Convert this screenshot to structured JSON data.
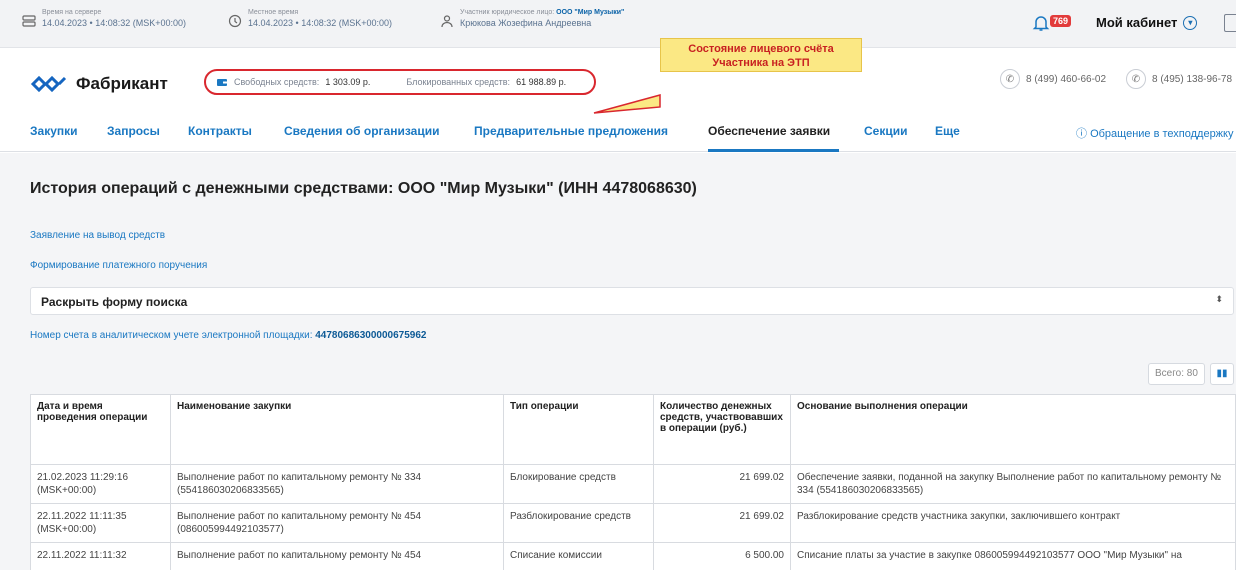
{
  "topbar": {
    "server_time_label": "Время на сервере",
    "server_time_value": "14.04.2023 • 14:08:32 (MSK+00:00)",
    "local_time_label": "Местное время",
    "local_time_value": "14.04.2023 • 14:08:32 (MSK+00:00)",
    "participant_label": "Участник юридическое лицо:",
    "participant_org": "ООО \"Мир Музыки\"",
    "participant_name": "Крюкова Жозефина Андреевна",
    "notifications_count": "769",
    "cabinet_label": "Мой кабинет"
  },
  "header": {
    "logo_text": "Фабрикант",
    "free_funds_label": "Свободных средств:",
    "free_funds_value": "1 303.09 р.",
    "blocked_funds_label": "Блокированных средств:",
    "blocked_funds_value": "61 988.89 р.",
    "callout_line1": "Состояние лицевого счёта",
    "callout_line2": "Участника на ЭТП",
    "phone1": "8 (499) 460-66-02",
    "phone2": "8 (495) 138-96-78"
  },
  "nav": {
    "items": [
      "Закупки",
      "Запросы",
      "Контракты",
      "Сведения об организации",
      "Предварительные предложения",
      "Обеспечение заявки",
      "Секции",
      "Еще"
    ],
    "active_index": 5,
    "support": "Обращение в техподдержку"
  },
  "page": {
    "title": "История операций с денежными средствами: ООО \"Мир Музыки\" (ИНН 4478068630)",
    "link_withdraw": "Заявление на вывод средств",
    "link_payment": "Формирование платежного поручения",
    "search_toggle": "Раскрыть форму поиска",
    "account_label": "Номер счета в аналитическом учете электронной площадки:",
    "account_number": "44780686300000675962",
    "total_label": "Всего: 80"
  },
  "table": {
    "headers": [
      "Дата и время проведения операции",
      "Наименование закупки",
      "Тип операции",
      "Количество денежных средств, участвовавших в операции (руб.)",
      "Основание выполнения операции"
    ],
    "rows": [
      [
        "21.02.2023 11:29:16 (MSK+00:00)",
        "Выполнение работ по капитальному ремонту № 334 (554186030206833565)",
        "Блокирование средств",
        "21 699.02",
        "Обеспечение заявки, поданной на закупку Выполнение работ по капитальному ремонту № 334 (554186030206833565)"
      ],
      [
        "22.11.2022 11:11:35 (MSK+00:00)",
        "Выполнение работ по капитальному ремонту № 454 (086005994492103577)",
        "Разблокирование средств",
        "21 699.02",
        "Разблокирование средств участника закупки, заключившего контракт"
      ],
      [
        "22.11.2022 11:11:32",
        "Выполнение работ по капитальному ремонту № 454",
        "Списание комиссии",
        "6 500.00",
        "Списание платы за участие в закупке 086005994492103577 ООО \"Мир Музыки\" на"
      ]
    ]
  }
}
